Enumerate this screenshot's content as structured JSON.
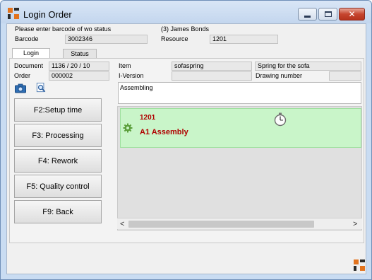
{
  "window": {
    "title": "Login Order",
    "icon": "app-logo-icon"
  },
  "titlebar_buttons": {
    "minimize": "minimize-icon",
    "maximize": "maximize-icon",
    "close": "close-icon"
  },
  "header": {
    "prompt": "Please enter barcode of wo status",
    "user": "(3) James Bonds",
    "barcode_label": "Barcode",
    "barcode_value": "3002346",
    "resource_label": "Resource",
    "resource_value": "1201"
  },
  "tabs": [
    {
      "label": "Login",
      "active": true
    },
    {
      "label": "Status",
      "active": false
    }
  ],
  "details": {
    "document_label": "Document",
    "document_value": "1136 / 20 / 10",
    "order_label": "Order",
    "order_value": "000002",
    "item_label": "Item",
    "item_value": "sofaspring",
    "item_desc": "Spring for the sofa",
    "iversion_label": "I-Version",
    "iversion_value": "",
    "drawing_label": "Drawing number",
    "drawing_value": "",
    "operation_text": "Assembling"
  },
  "toolbar": {
    "camera_icon": "camera-icon",
    "search_icon": "document-search-icon"
  },
  "function_keys": [
    {
      "label": "F2:Setup time"
    },
    {
      "label": "F3: Processing"
    },
    {
      "label": "F4: Rework"
    },
    {
      "label": "F5: Quality control"
    },
    {
      "label": "F9: Back"
    }
  ],
  "status_card": {
    "resource": "1201",
    "operation": "A1 Assembly",
    "gear_icon": "gear-icon",
    "stopwatch_icon": "stopwatch-icon",
    "colors": {
      "background": "#c9f5c9",
      "text": "#b00000"
    }
  },
  "scrollbar": {
    "left": "<",
    "right": ">"
  },
  "footer": {
    "logo_icon": "app-logo-icon"
  }
}
